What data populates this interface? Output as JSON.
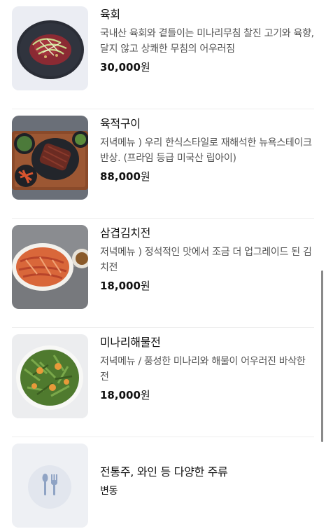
{
  "menu": {
    "items": [
      {
        "name": "육회",
        "description": "국내산 육회와 곁들이는 미나리무침 찰진 고기와 육향, 달지 않고 상쾌한 무침의 어우러짐",
        "price": "30,000",
        "currency": "원",
        "image_icon": "yukhoe-photo"
      },
      {
        "name": "육적구이",
        "description": "저녁메뉴 ) 우리 한식스타일로 재해석한 뉴욕스테이크 반상. (프라임 등급 미국산 립아이)",
        "price": "88,000",
        "currency": "원",
        "image_icon": "steak-platter-photo"
      },
      {
        "name": "삼겹김치전",
        "description": "저녁메뉴 ) 정석적인 맛에서 조금 더 업그레이드 된 김치전",
        "price": "18,000",
        "currency": "원",
        "image_icon": "kimchi-pancake-photo"
      },
      {
        "name": "미나리해물전",
        "description": "저녁메뉴 / 풍성한 미나리와 해물이 어우러진 바삭한 전",
        "price": "18,000",
        "currency": "원",
        "image_icon": "seafood-pancake-photo"
      },
      {
        "name": "전통주, 와인 등 다양한 주류",
        "price_note": "변동",
        "image_icon": "utensils-icon"
      }
    ]
  },
  "colors": {
    "divider": "#eeeeee",
    "description_text": "#555555",
    "placeholder_bg": "#eceef3",
    "utensils_icon": "#8fa3c4"
  }
}
